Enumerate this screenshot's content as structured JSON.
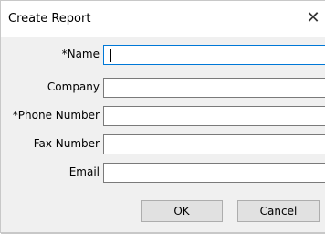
{
  "window": {
    "title": "Create Report"
  },
  "icons": {
    "close": "close-icon"
  },
  "form": {
    "fields": [
      {
        "label": "*Name",
        "value": ""
      },
      {
        "label": "Company",
        "value": ""
      },
      {
        "label": "*Phone Number",
        "value": ""
      },
      {
        "label": "Fax Number",
        "value": ""
      },
      {
        "label": "Email",
        "value": ""
      }
    ]
  },
  "buttons": {
    "ok": "OK",
    "cancel": "Cancel"
  },
  "colors": {
    "focus_border": "#0078d7",
    "dialog_bg": "#f0f0f0"
  }
}
